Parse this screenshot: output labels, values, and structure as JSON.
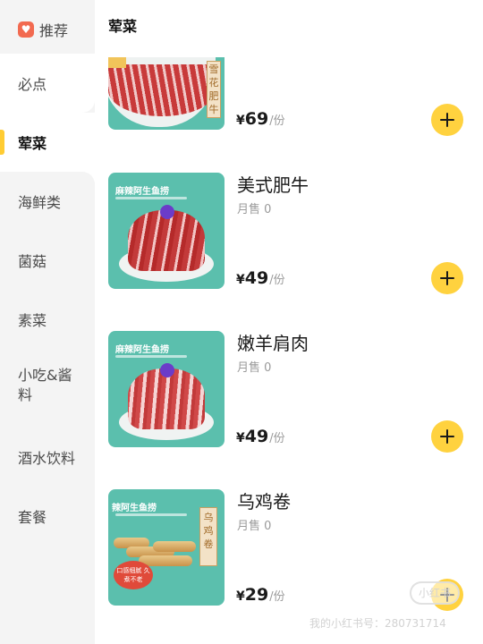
{
  "sidebar": {
    "items": [
      {
        "label": "推荐",
        "icon": "recommend-heart-icon"
      },
      {
        "label": "必点"
      },
      {
        "label": "荤菜",
        "active": true
      },
      {
        "label": "海鲜类"
      },
      {
        "label": "菌菇"
      },
      {
        "label": "素菜"
      },
      {
        "label": "小吃&酱料"
      },
      {
        "label": "酒水饮料"
      },
      {
        "label": "套餐"
      }
    ]
  },
  "main": {
    "section_title": "荤菜",
    "dishes": [
      {
        "name": "",
        "price_symbol": "¥",
        "price": "69",
        "unit": "/份",
        "image_tag": "雪花肥牛"
      },
      {
        "name": "美式肥牛",
        "sold": "月售 0",
        "price_symbol": "¥",
        "price": "49",
        "unit": "/份",
        "brand": "麻辣阿生鱼捞"
      },
      {
        "name": "嫩羊肩肉",
        "sold": "月售 0",
        "price_symbol": "¥",
        "price": "49",
        "unit": "/份",
        "brand": "麻辣阿生鱼捞"
      },
      {
        "name": "乌鸡卷",
        "sold": "月售 0",
        "price_symbol": "¥",
        "price": "29",
        "unit": "/份",
        "brand": "辣阿生鱼捞",
        "image_tag": "乌鸡卷",
        "badge": "口感细腻 久煮不老"
      }
    ]
  },
  "watermark": {
    "logo": "小红书",
    "text": "我的小红书号：280731714"
  },
  "colors": {
    "accent": "#ffd23f",
    "sidebar_bg": "#f4f4f4",
    "image_bg": "#5bbfad"
  }
}
